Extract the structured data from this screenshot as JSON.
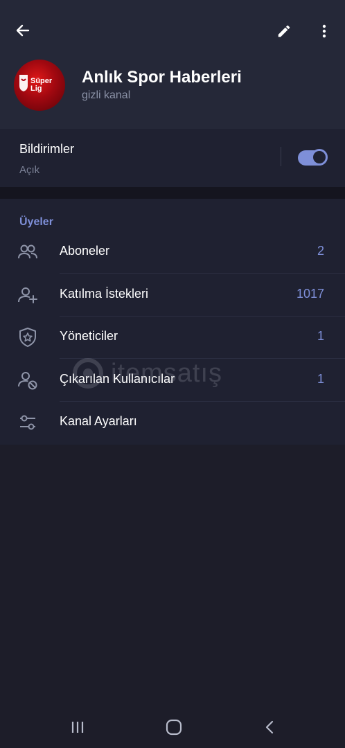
{
  "header": {
    "title": "Anlık Spor Haberleri",
    "subtitle": "gizli kanal",
    "back_icon": "arrow-left-icon",
    "edit_icon": "pencil-icon",
    "more_icon": "more-vertical-icon",
    "avatar_logo_text": "Süper Lig"
  },
  "notifications": {
    "label": "Bildirimler",
    "status": "Açık",
    "enabled": true
  },
  "members": {
    "section_title": "Üyeler",
    "items": [
      {
        "label": "Aboneler",
        "value": "2",
        "icon": "users-icon"
      },
      {
        "label": "Katılma İstekleri",
        "value": "1017",
        "icon": "user-plus-icon"
      },
      {
        "label": "Yöneticiler",
        "value": "1",
        "icon": "shield-star-icon"
      },
      {
        "label": "Çıkarılan Kullanıcılar",
        "value": "1",
        "icon": "user-blocked-icon"
      },
      {
        "label": "Kanal Ayarları",
        "value": "",
        "icon": "sliders-icon"
      }
    ]
  },
  "watermark": {
    "text": "itemsatış"
  },
  "navbar": {
    "recents_icon": "recents-icon",
    "home_icon": "home-icon",
    "back_icon": "nav-back-icon"
  },
  "colors": {
    "accent": "#7e8fd8",
    "header_bg": "#252838",
    "panel_bg": "#1f2131",
    "page_bg": "#1d1d29"
  }
}
